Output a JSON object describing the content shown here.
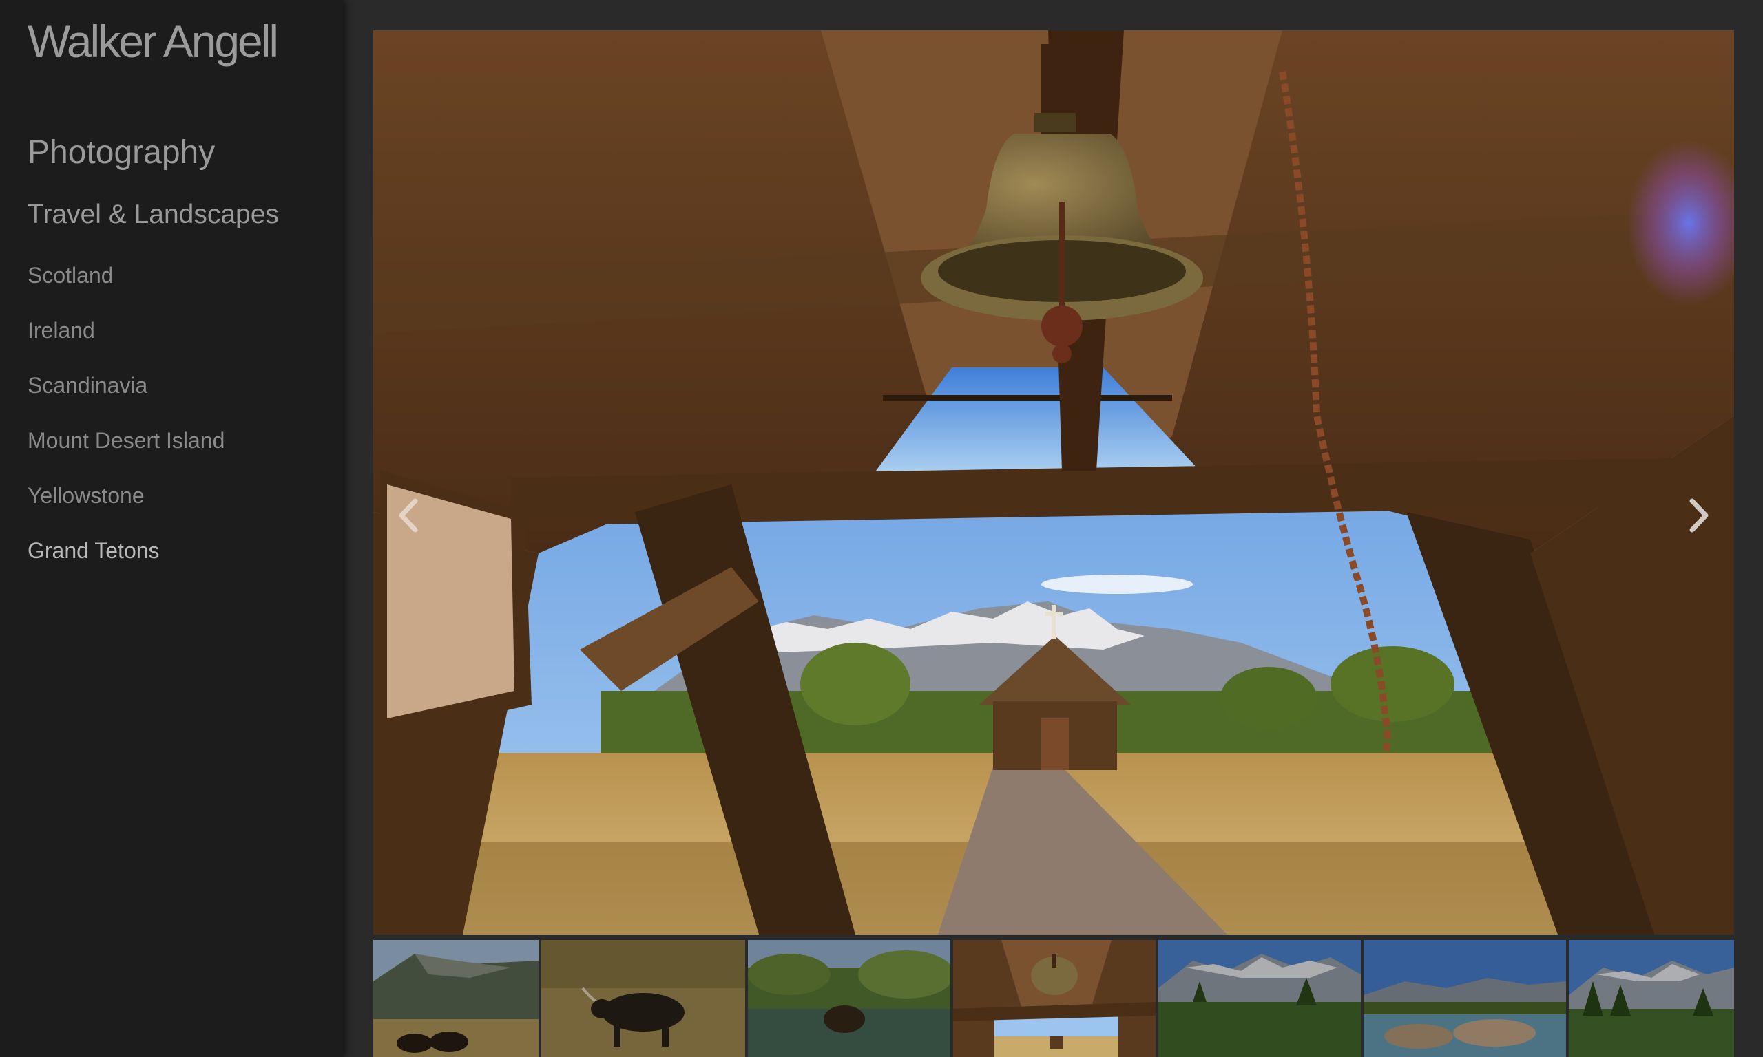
{
  "site": {
    "logo": "Walker Angell"
  },
  "nav": {
    "section_title": "Photography",
    "subsection_title": "Travel & Landscapes",
    "items": [
      {
        "label": "Scotland"
      },
      {
        "label": "Ireland"
      },
      {
        "label": "Scandinavia"
      },
      {
        "label": "Mount Desert Island"
      },
      {
        "label": "Yellowstone"
      },
      {
        "label": "Grand Tetons"
      }
    ],
    "active_item": "Grand Tetons"
  },
  "viewer": {
    "prev_icon": "chevron-left-icon",
    "next_icon": "chevron-right-icon"
  },
  "thumbnails": [
    {
      "icon": "mountain-bison-thumb"
    },
    {
      "icon": "longhorn-thumb"
    },
    {
      "icon": "moose-pond-thumb"
    },
    {
      "icon": "chapel-bell-thumb",
      "active": true
    },
    {
      "icon": "teton-forest-thumb"
    },
    {
      "icon": "lake-rocks-thumb"
    },
    {
      "icon": "teton-pines-thumb"
    }
  ],
  "colors": {
    "sidebar_bg": "#1c1c1d",
    "main_bg": "#2a2a2a",
    "nav_text": "#8a8a8a",
    "nav_active": "#b8b8b8"
  }
}
